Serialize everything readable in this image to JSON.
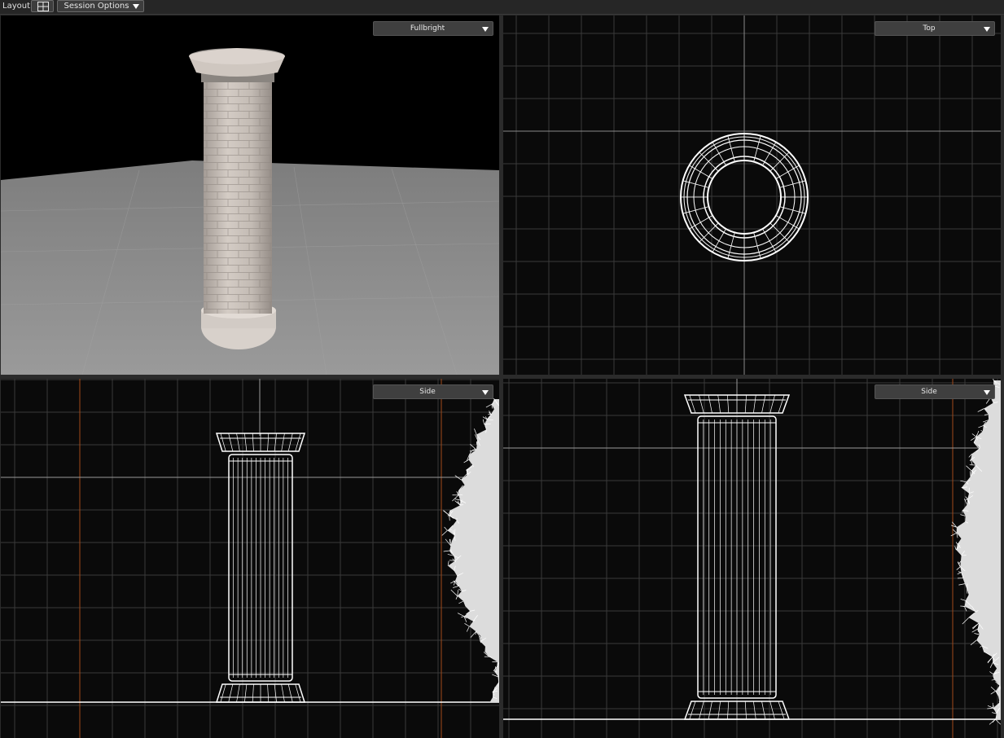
{
  "toolbar": {
    "layout_label": "Layout:",
    "layout_icon": "grid-four-pane-icon",
    "session_options_label": "Session Options"
  },
  "viewports": {
    "perspective": {
      "mode_label": "Fullbright"
    },
    "top": {
      "view_label": "Top"
    },
    "side_left": {
      "view_label": "Side"
    },
    "side_right": {
      "view_label": "Side"
    }
  },
  "colors": {
    "viewport_bg": "#0a0a0a",
    "grid_line": "#3a3a3a",
    "axis_orange": "#a34a1a",
    "wireframe": "#ffffff",
    "floor": "#8f8f8f"
  }
}
